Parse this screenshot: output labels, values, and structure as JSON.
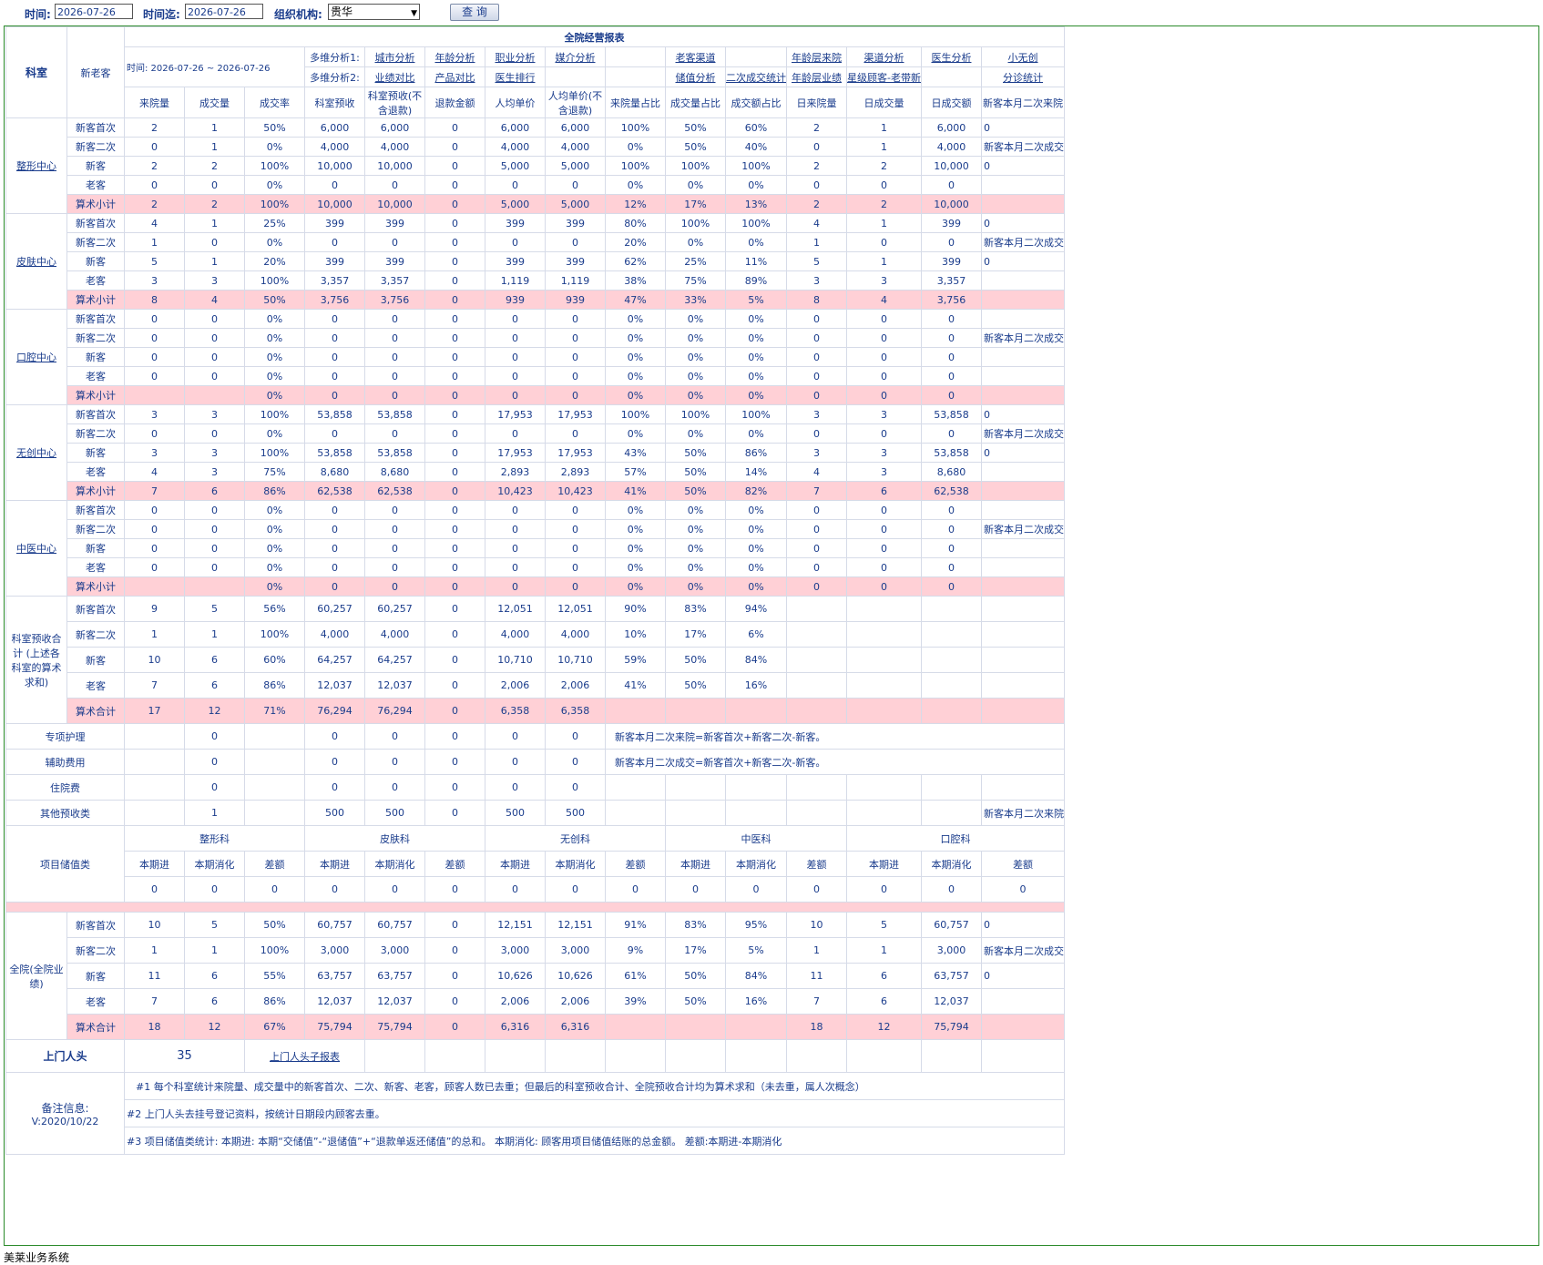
{
  "topbar": {
    "time_label": "时间:",
    "time_value": "2026-07-26",
    "until_label": "时间迄:",
    "until_value": "2026-07-26",
    "org_label": "组织机构:",
    "org_value": "贵华",
    "query_button": "查 询"
  },
  "report": {
    "title": "全院经营报表",
    "dept_header": "科室",
    "type_header": "新老客",
    "time_range": "时间: 2026-07-26 ~ 2026-07-26",
    "multi1": "多维分析1:",
    "multi2": "多维分析2:",
    "links_row1": [
      "城市分析",
      "年龄分析",
      "职业分析",
      "媒介分析",
      "",
      "老客渠道",
      "",
      "年龄层来院",
      "渠道分析",
      "医生分析",
      "小无创"
    ],
    "links_row2": [
      "业绩对比",
      "产品对比",
      "医生排行",
      "",
      "",
      "储值分析",
      "二次成交统计",
      "年龄层业绩",
      "星级顾客-老带新",
      "",
      "分诊统计"
    ],
    "col_headers": [
      "来院量",
      "成交量",
      "成交率",
      "科室预收",
      "科室预收(不含退款)",
      "退款金额",
      "人均单价",
      "人均单价(不含退款)",
      "来院量占比",
      "成交量占比",
      "成交额占比",
      "日来院量",
      "日成交量",
      "日成交额",
      "新客本月二次来院"
    ],
    "departments": [
      {
        "name": "整形中心",
        "rows": [
          {
            "label": "新客首次",
            "cells": [
              "2",
              "1",
              "50%",
              "6,000",
              "6,000",
              "0",
              "6,000",
              "6,000",
              "100%",
              "50%",
              "60%",
              "2",
              "1",
              "6,000",
              "0"
            ]
          },
          {
            "label": "新客二次",
            "cells": [
              "0",
              "1",
              "0%",
              "4,000",
              "4,000",
              "0",
              "4,000",
              "4,000",
              "0%",
              "50%",
              "40%",
              "0",
              "1",
              "4,000",
              "新客本月二次成交"
            ]
          },
          {
            "label": "新客",
            "cells": [
              "2",
              "2",
              "100%",
              "10,000",
              "10,000",
              "0",
              "5,000",
              "5,000",
              "100%",
              "100%",
              "100%",
              "2",
              "2",
              "10,000",
              "0"
            ]
          },
          {
            "label": "老客",
            "cells": [
              "0",
              "0",
              "0%",
              "0",
              "0",
              "0",
              "0",
              "0",
              "0%",
              "0%",
              "0%",
              "0",
              "0",
              "0",
              ""
            ]
          },
          {
            "label": "算术小计",
            "cells": [
              "2",
              "2",
              "100%",
              "10,000",
              "10,000",
              "0",
              "5,000",
              "5,000",
              "12%",
              "17%",
              "13%",
              "2",
              "2",
              "10,000",
              ""
            ]
          }
        ]
      },
      {
        "name": "皮肤中心",
        "rows": [
          {
            "label": "新客首次",
            "cells": [
              "4",
              "1",
              "25%",
              "399",
              "399",
              "0",
              "399",
              "399",
              "80%",
              "100%",
              "100%",
              "4",
              "1",
              "399",
              "0"
            ]
          },
          {
            "label": "新客二次",
            "cells": [
              "1",
              "0",
              "0%",
              "0",
              "0",
              "0",
              "0",
              "0",
              "20%",
              "0%",
              "0%",
              "1",
              "0",
              "0",
              "新客本月二次成交"
            ]
          },
          {
            "label": "新客",
            "cells": [
              "5",
              "1",
              "20%",
              "399",
              "399",
              "0",
              "399",
              "399",
              "62%",
              "25%",
              "11%",
              "5",
              "1",
              "399",
              "0"
            ]
          },
          {
            "label": "老客",
            "cells": [
              "3",
              "3",
              "100%",
              "3,357",
              "3,357",
              "0",
              "1,119",
              "1,119",
              "38%",
              "75%",
              "89%",
              "3",
              "3",
              "3,357",
              ""
            ]
          },
          {
            "label": "算术小计",
            "cells": [
              "8",
              "4",
              "50%",
              "3,756",
              "3,756",
              "0",
              "939",
              "939",
              "47%",
              "33%",
              "5%",
              "8",
              "4",
              "3,756",
              ""
            ]
          }
        ]
      },
      {
        "name": "口腔中心",
        "rows": [
          {
            "label": "新客首次",
            "cells": [
              "0",
              "0",
              "0%",
              "0",
              "0",
              "0",
              "0",
              "0",
              "0%",
              "0%",
              "0%",
              "0",
              "0",
              "0",
              ""
            ]
          },
          {
            "label": "新客二次",
            "cells": [
              "0",
              "0",
              "0%",
              "0",
              "0",
              "0",
              "0",
              "0",
              "0%",
              "0%",
              "0%",
              "0",
              "0",
              "0",
              "新客本月二次成交"
            ]
          },
          {
            "label": "新客",
            "cells": [
              "0",
              "0",
              "0%",
              "0",
              "0",
              "0",
              "0",
              "0",
              "0%",
              "0%",
              "0%",
              "0",
              "0",
              "0",
              ""
            ]
          },
          {
            "label": "老客",
            "cells": [
              "0",
              "0",
              "0%",
              "0",
              "0",
              "0",
              "0",
              "0",
              "0%",
              "0%",
              "0%",
              "0",
              "0",
              "0",
              ""
            ]
          },
          {
            "label": "算术小计",
            "cells": [
              "",
              "",
              "0%",
              "0",
              "0",
              "0",
              "0",
              "0",
              "0%",
              "0%",
              "0%",
              "0",
              "0",
              "0",
              ""
            ]
          }
        ]
      },
      {
        "name": "无创中心",
        "rows": [
          {
            "label": "新客首次",
            "cells": [
              "3",
              "3",
              "100%",
              "53,858",
              "53,858",
              "0",
              "17,953",
              "17,953",
              "100%",
              "100%",
              "100%",
              "3",
              "3",
              "53,858",
              "0"
            ]
          },
          {
            "label": "新客二次",
            "cells": [
              "0",
              "0",
              "0%",
              "0",
              "0",
              "0",
              "0",
              "0",
              "0%",
              "0%",
              "0%",
              "0",
              "0",
              "0",
              "新客本月二次成交"
            ]
          },
          {
            "label": "新客",
            "cells": [
              "3",
              "3",
              "100%",
              "53,858",
              "53,858",
              "0",
              "17,953",
              "17,953",
              "43%",
              "50%",
              "86%",
              "3",
              "3",
              "53,858",
              "0"
            ]
          },
          {
            "label": "老客",
            "cells": [
              "4",
              "3",
              "75%",
              "8,680",
              "8,680",
              "0",
              "2,893",
              "2,893",
              "57%",
              "50%",
              "14%",
              "4",
              "3",
              "8,680",
              ""
            ]
          },
          {
            "label": "算术小计",
            "cells": [
              "7",
              "6",
              "86%",
              "62,538",
              "62,538",
              "0",
              "10,423",
              "10,423",
              "41%",
              "50%",
              "82%",
              "7",
              "6",
              "62,538",
              ""
            ]
          }
        ]
      },
      {
        "name": "中医中心",
        "rows": [
          {
            "label": "新客首次",
            "cells": [
              "0",
              "0",
              "0%",
              "0",
              "0",
              "0",
              "0",
              "0",
              "0%",
              "0%",
              "0%",
              "0",
              "0",
              "0",
              ""
            ]
          },
          {
            "label": "新客二次",
            "cells": [
              "0",
              "0",
              "0%",
              "0",
              "0",
              "0",
              "0",
              "0",
              "0%",
              "0%",
              "0%",
              "0",
              "0",
              "0",
              "新客本月二次成交"
            ]
          },
          {
            "label": "新客",
            "cells": [
              "0",
              "0",
              "0%",
              "0",
              "0",
              "0",
              "0",
              "0",
              "0%",
              "0%",
              "0%",
              "0",
              "0",
              "0",
              ""
            ]
          },
          {
            "label": "老客",
            "cells": [
              "0",
              "0",
              "0%",
              "0",
              "0",
              "0",
              "0",
              "0",
              "0%",
              "0%",
              "0%",
              "0",
              "0",
              "0",
              ""
            ]
          },
          {
            "label": "算术小计",
            "cells": [
              "",
              "",
              "0%",
              "0",
              "0",
              "0",
              "0",
              "0",
              "0%",
              "0%",
              "0%",
              "0",
              "0",
              "0",
              ""
            ]
          }
        ]
      }
    ],
    "dept_total": {
      "name": "科室预收合计 (上述各科室的算术求和)",
      "rows": [
        {
          "label": "新客首次",
          "cells": [
            "9",
            "5",
            "56%",
            "60,257",
            "60,257",
            "0",
            "12,051",
            "12,051",
            "90%",
            "83%",
            "94%",
            "",
            "",
            "",
            ""
          ]
        },
        {
          "label": "新客二次",
          "cells": [
            "1",
            "1",
            "100%",
            "4,000",
            "4,000",
            "0",
            "4,000",
            "4,000",
            "10%",
            "17%",
            "6%",
            "",
            "",
            "",
            ""
          ]
        },
        {
          "label": "新客",
          "cells": [
            "10",
            "6",
            "60%",
            "64,257",
            "64,257",
            "0",
            "10,710",
            "10,710",
            "59%",
            "50%",
            "84%",
            "",
            "",
            "",
            ""
          ]
        },
        {
          "label": "老客",
          "cells": [
            "7",
            "6",
            "86%",
            "12,037",
            "12,037",
            "0",
            "2,006",
            "2,006",
            "41%",
            "50%",
            "16%",
            "",
            "",
            "",
            ""
          ]
        },
        {
          "label": "算术合计",
          "cells": [
            "17",
            "12",
            "71%",
            "76,294",
            "76,294",
            "0",
            "6,358",
            "6,358",
            "",
            "",
            "",
            "",
            "",
            "",
            ""
          ]
        }
      ]
    },
    "extra_rows": [
      {
        "label": "专项护理",
        "cells": [
          "",
          "0",
          "",
          "0",
          "0",
          "0",
          "0",
          "0"
        ],
        "note": "新客本月二次来院=新客首次+新客二次-新客。"
      },
      {
        "label": "辅助费用",
        "cells": [
          "",
          "0",
          "",
          "0",
          "0",
          "0",
          "0",
          "0"
        ],
        "note": "新客本月二次成交=新客首次+新客二次-新客。"
      },
      {
        "label": "住院费",
        "cells": [
          "",
          "0",
          "",
          "0",
          "0",
          "0",
          "0",
          "0"
        ],
        "note": ""
      },
      {
        "label": "其他预收类",
        "cells": [
          "",
          "1",
          "",
          "500",
          "500",
          "0",
          "500",
          "500"
        ],
        "note": "",
        "last": "新客本月二次来院"
      }
    ],
    "stored": {
      "label": "项目储值类",
      "depts": [
        "整形科",
        "皮肤科",
        "无创科",
        "中医科",
        "口腔科"
      ],
      "sub_headers": [
        "本期进",
        "本期消化",
        "差额"
      ],
      "values": [
        "0",
        "0",
        "0",
        "0",
        "0",
        "0",
        "0",
        "0",
        "0",
        "0",
        "0",
        "0",
        "0",
        "0",
        "0"
      ]
    },
    "hospital": {
      "name": "全院(全院业绩)",
      "rows": [
        {
          "label": "新客首次",
          "cells": [
            "10",
            "5",
            "50%",
            "60,757",
            "60,757",
            "0",
            "12,151",
            "12,151",
            "91%",
            "83%",
            "95%",
            "10",
            "5",
            "60,757",
            "0"
          ]
        },
        {
          "label": "新客二次",
          "cells": [
            "1",
            "1",
            "100%",
            "3,000",
            "3,000",
            "0",
            "3,000",
            "3,000",
            "9%",
            "17%",
            "5%",
            "1",
            "1",
            "3,000",
            "新客本月二次成交"
          ]
        },
        {
          "label": "新客",
          "cells": [
            "11",
            "6",
            "55%",
            "63,757",
            "63,757",
            "0",
            "10,626",
            "10,626",
            "61%",
            "50%",
            "84%",
            "11",
            "6",
            "63,757",
            "0"
          ]
        },
        {
          "label": "老客",
          "cells": [
            "7",
            "6",
            "86%",
            "12,037",
            "12,037",
            "0",
            "2,006",
            "2,006",
            "39%",
            "50%",
            "16%",
            "7",
            "6",
            "12,037",
            ""
          ]
        },
        {
          "label": "算术合计",
          "cells": [
            "18",
            "12",
            "67%",
            "75,794",
            "75,794",
            "0",
            "6,316",
            "6,316",
            "",
            "",
            "",
            "18",
            "12",
            "75,794",
            ""
          ]
        }
      ]
    },
    "visitors": {
      "label": "上门人头",
      "value": "35",
      "link": "上门人头子报表"
    },
    "notes": {
      "label": "备注信息:",
      "version": "V:2020/10/22",
      "lines": [
        "#1  每个科室统计来院量、成交量中的新客首次、二次、新客、老客，顾客人数已去重；但最后的科室预收合计、全院预收合计均为算术求和（未去重，属人次概念）",
        "#2  上门人头去挂号登记资料，按统计日期段内顾客去重。",
        "#3    项目储值类统计:    本期进:    本期“交储值”-“退储值”+“退款单返还储值”的总和。    本期消化:    顾客用项目储值结账的总金额。    差额:本期进-本期消化"
      ]
    }
  },
  "footer": "美莱业务系统"
}
